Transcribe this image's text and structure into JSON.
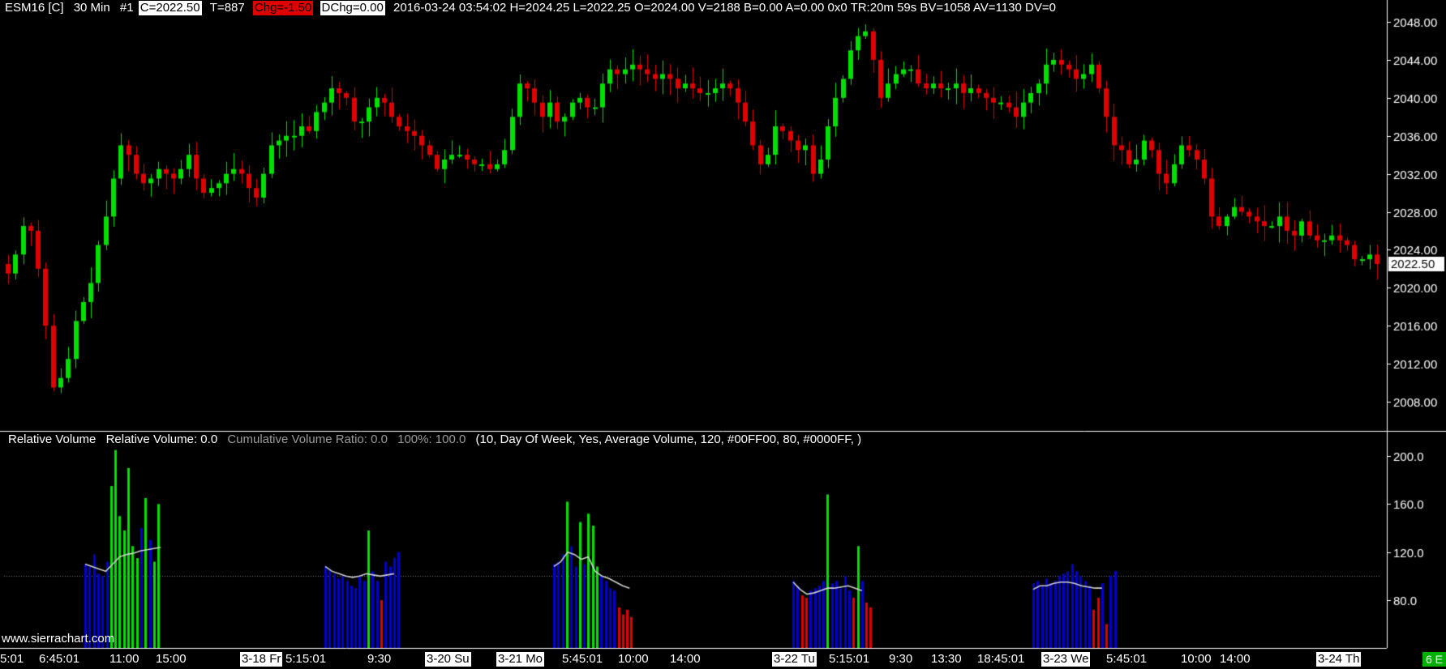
{
  "header": {
    "symbol": "ESM16 [C]",
    "interval": "30 Min",
    "chart_no": "#1",
    "close": "C=2022.50",
    "trades": "T=887",
    "change": "Chg=-1.50",
    "dchange": "DChg=0.00",
    "details": "2016-03-24 03:54:02 H=2024.25 L=2022.25 O=2024.00 V=2188 B=0.00 A=0.00 0x0 TR:20m 59s BV=1058 AV=1130 DV=0"
  },
  "study": {
    "name": "Relative Volume",
    "relative_volume": "Relative Volume: 0.0",
    "cumulative_ratio": "Cumulative Volume Ratio: 0.0",
    "hundred_pct": "100%: 100.0",
    "params": "(10, Day Of Week, Yes, Average Volume, 120, #00FF00, 80, #0000FF, )"
  },
  "watermark": "www.sierrachart.com",
  "corner_tag": "6 E",
  "colors": {
    "up": "#00e000",
    "down": "#e00000",
    "blue": "#0000cc",
    "line": "#d0d0d0",
    "ref": "#808080"
  },
  "x_labels": [
    {
      "text": "5:01",
      "highlight": false
    },
    {
      "text": "6:45:01",
      "highlight": false
    },
    {
      "text": "11:00",
      "highlight": false
    },
    {
      "text": "15:00",
      "highlight": false
    },
    {
      "text": "3-18 Fr",
      "highlight": true
    },
    {
      "text": "5:15:01",
      "highlight": false
    },
    {
      "text": "9:30",
      "highlight": false
    },
    {
      "text": "3-20 Su",
      "highlight": true
    },
    {
      "text": "3-21 Mo",
      "highlight": true
    },
    {
      "text": "5:45:01",
      "highlight": false
    },
    {
      "text": "10:00",
      "highlight": false
    },
    {
      "text": "14:00",
      "highlight": false
    },
    {
      "text": "3-22 Tu",
      "highlight": true
    },
    {
      "text": "5:15:01",
      "highlight": false
    },
    {
      "text": "9:30",
      "highlight": false
    },
    {
      "text": "13:30",
      "highlight": false
    },
    {
      "text": "18:45:01",
      "highlight": false
    },
    {
      "text": "3-23 We",
      "highlight": true
    },
    {
      "text": "5:45:01",
      "highlight": false
    },
    {
      "text": "10:00",
      "highlight": false
    },
    {
      "text": "14:00",
      "highlight": false
    },
    {
      "text": "3-24 Th",
      "highlight": true
    }
  ],
  "chart_data": [
    {
      "type": "candlestick",
      "ylim": [
        2005,
        2049
      ],
      "y_ticks": [
        "2048.00",
        "2044.00",
        "2040.00",
        "2036.00",
        "2032.00",
        "2028.00",
        "2024.00",
        "2020.00",
        "2016.00",
        "2012.00",
        "2008.00"
      ],
      "last_price": "2022.50",
      "close": [
        2021.5,
        2023.5,
        2026.5,
        2026.0,
        2022.0,
        2016.0,
        2009.5,
        2010.5,
        2012.5,
        2016.5,
        2018.5,
        2020.5,
        2024.5,
        2027.5,
        2031.5,
        2035.0,
        2034.0,
        2032.0,
        2031.0,
        2031.5,
        2032.5,
        2032.0,
        2031.5,
        2032.5,
        2034.0,
        2031.5,
        2030.0,
        2030.5,
        2031.0,
        2032.0,
        2032.5,
        2032.0,
        2030.5,
        2029.5,
        2032.0,
        2035.0,
        2035.5,
        2036.0,
        2036.0,
        2037.0,
        2036.5,
        2038.5,
        2039.5,
        2041.0,
        2040.5,
        2040.0,
        2037.5,
        2037.5,
        2039.0,
        2040.0,
        2039.5,
        2038.0,
        2037.0,
        2036.5,
        2036.0,
        2035.0,
        2034.0,
        2032.5,
        2033.5,
        2034.0,
        2034.0,
        2033.5,
        2033.0,
        2033.0,
        2032.5,
        2033.0,
        2034.5,
        2038.0,
        2041.5,
        2041.0,
        2039.5,
        2038.0,
        2039.5,
        2037.5,
        2038.0,
        2039.5,
        2040.0,
        2039.0,
        2039.0,
        2041.5,
        2043.0,
        2042.5,
        2043.0,
        2043.5,
        2043.0,
        2042.5,
        2042.0,
        2042.5,
        2042.0,
        2041.0,
        2041.5,
        2041.0,
        2040.5,
        2040.5,
        2041.0,
        2041.5,
        2041.0,
        2039.5,
        2037.5,
        2035.0,
        2033.0,
        2034.0,
        2037.0,
        2036.5,
        2035.5,
        2034.5,
        2035.0,
        2032.0,
        2033.5,
        2037.0,
        2040.0,
        2042.0,
        2045.0,
        2046.5,
        2047.0,
        2044.0,
        2040.0,
        2041.5,
        2042.5,
        2043.0,
        2043.0,
        2041.5,
        2041.0,
        2041.5,
        2041.0,
        2041.0,
        2041.5,
        2040.5,
        2041.0,
        2040.5,
        2040.0,
        2039.5,
        2039.5,
        2039.0,
        2038.0,
        2039.5,
        2040.5,
        2041.5,
        2043.5,
        2044.0,
        2043.5,
        2043.0,
        2042.0,
        2042.5,
        2043.5,
        2041.0,
        2038.0,
        2035.0,
        2034.5,
        2033.0,
        2033.5,
        2035.5,
        2034.5,
        2032.0,
        2031.0,
        2033.0,
        2035.0,
        2034.5,
        2033.5,
        2031.5,
        2027.5,
        2026.5,
        2027.5,
        2028.5,
        2028.0,
        2027.5,
        2027.0,
        2026.5,
        2026.5,
        2027.5,
        2026.0,
        2025.5,
        2027.0,
        2025.5,
        2025.0,
        2025.0,
        2025.5,
        2025.0,
        2024.5,
        2023.0,
        2023.0,
        2023.5,
        2022.5
      ]
    },
    {
      "type": "bar",
      "ylim": [
        55,
        210
      ],
      "y_ticks": [
        "200.0",
        "160.0",
        "120.0",
        "80.0"
      ],
      "reference_line": 100,
      "sessions": [
        {
          "start": 104,
          "colors": "bbbbbbgggggggbgbgg",
          "values": [
            110,
            108,
            118,
            102,
            100,
            112,
            175,
            205,
            150,
            138,
            190,
            125,
            115,
            140,
            165,
            130,
            112,
            160
          ],
          "avg": [
            110,
            108,
            106,
            104,
            110,
            116,
            118,
            119,
            121,
            122,
            123,
            124
          ]
        },
        {
          "start": 400,
          "colors": "bbbbbbbbbbgbbrbbbb",
          "values": [
            108,
            105,
            102,
            98,
            100,
            96,
            92,
            90,
            100,
            96,
            138,
            104,
            96,
            80,
            112,
            108,
            115,
            120
          ],
          "avg": [
            108,
            104,
            102,
            100,
            99,
            100,
            102,
            101,
            100,
            101,
            102
          ]
        },
        {
          "start": 682,
          "colors": "bbbgbbgbgggbbbbrrrr",
          "values": [
            110,
            112,
            118,
            162,
            125,
            108,
            145,
            110,
            152,
            142,
            108,
            100,
            96,
            90,
            88,
            74,
            68,
            72,
            66
          ],
          "avg": [
            108,
            112,
            120,
            118,
            114,
            116,
            104,
            100,
            98,
            95,
            92,
            90
          ]
        },
        {
          "start": 977,
          "colors": "bbrrbbbbgbbbbbrgbrr",
          "values": [
            96,
            92,
            84,
            82,
            88,
            90,
            92,
            96,
            168,
            94,
            96,
            90,
            100,
            88,
            82,
            125,
            96,
            78,
            74
          ],
          "avg": [
            95,
            89,
            85,
            86,
            88,
            90,
            90,
            91,
            92,
            90,
            88
          ]
        },
        {
          "start": 1273,
          "colors": "bbbbbbbbbbbbbbrrbrbb",
          "values": [
            94,
            96,
            92,
            98,
            94,
            96,
            100,
            102,
            104,
            110,
            104,
            100,
            96,
            92,
            72,
            82,
            94,
            60,
            100,
            104
          ],
          "avg": [
            89,
            92,
            92,
            94,
            95,
            95,
            94,
            92,
            91,
            90,
            90
          ]
        }
      ]
    }
  ]
}
